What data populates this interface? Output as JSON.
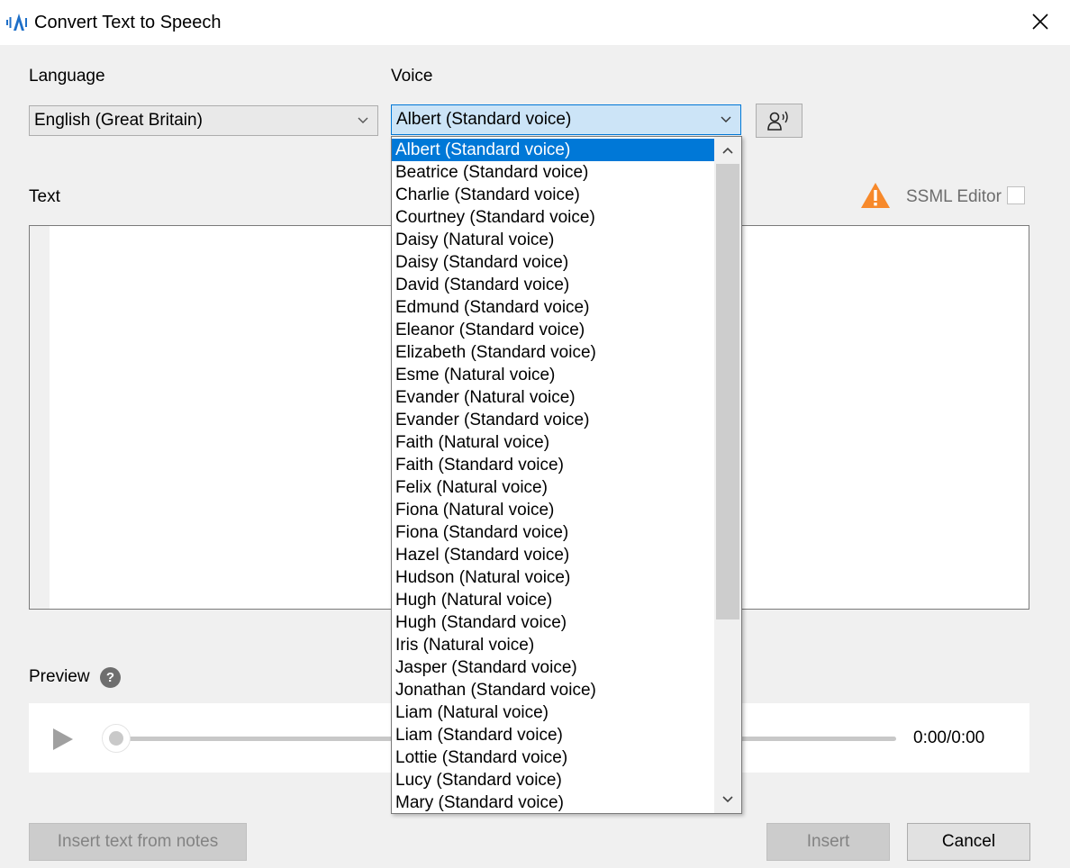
{
  "window": {
    "title": "Convert Text to Speech",
    "icon": "app-waveform-icon",
    "close_icon": "close-icon"
  },
  "language": {
    "label": "Language",
    "selected": "English (Great Britain)"
  },
  "voice": {
    "label": "Voice",
    "selected": "Albert (Standard voice)",
    "preview_voice_icon": "voice-speaker-icon",
    "options": [
      "Albert (Standard voice)",
      "Beatrice (Standard voice)",
      "Charlie (Standard voice)",
      "Courtney (Standard voice)",
      "Daisy (Natural voice)",
      "Daisy (Standard voice)",
      "David (Standard voice)",
      "Edmund (Standard voice)",
      "Eleanor (Standard voice)",
      "Elizabeth (Standard voice)",
      "Esme (Natural voice)",
      "Evander (Natural voice)",
      "Evander (Standard voice)",
      "Faith (Natural voice)",
      "Faith (Standard voice)",
      "Felix (Natural voice)",
      "Fiona (Natural voice)",
      "Fiona (Standard voice)",
      "Hazel (Standard voice)",
      "Hudson (Natural voice)",
      "Hugh (Natural voice)",
      "Hugh (Standard voice)",
      "Iris (Natural voice)",
      "Jasper (Standard voice)",
      "Jonathan (Standard voice)",
      "Liam (Natural voice)",
      "Liam (Standard voice)",
      "Lottie (Standard voice)",
      "Lucy (Standard voice)",
      "Mary (Standard voice)"
    ],
    "selected_index": 0
  },
  "text": {
    "label": "Text",
    "value": "",
    "warning_icon": "warning-icon",
    "ssml_label": "SSML Editor",
    "ssml_checked": false
  },
  "preview": {
    "label": "Preview",
    "help_icon": "help-icon",
    "help_glyph": "?",
    "play_icon": "play-icon",
    "time": "0:00/0:00",
    "progress": 0
  },
  "buttons": {
    "insert_from_notes": "Insert text from notes",
    "insert": "Insert",
    "cancel": "Cancel"
  },
  "colors": {
    "accent": "#0078d7",
    "warning": "#f7892b"
  }
}
